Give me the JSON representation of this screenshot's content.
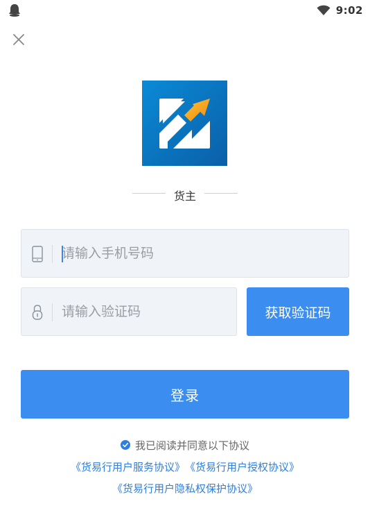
{
  "status_bar": {
    "time": "9:02",
    "left_icon": "notification-bell-icon",
    "signal_icon": "wifi-icon"
  },
  "close": {
    "icon": "close-icon"
  },
  "role": {
    "label": "货主"
  },
  "phone_field": {
    "icon": "phone-icon",
    "placeholder": "请输入手机号码",
    "value": ""
  },
  "code_field": {
    "icon": "lock-icon",
    "placeholder": "请输入验证码",
    "value": ""
  },
  "get_code_button": {
    "label": "获取验证码"
  },
  "login_button": {
    "label": "登录"
  },
  "agreement": {
    "checked": true,
    "text": "我已阅读并同意以下协议",
    "links": [
      "《货易行用户服务协议》",
      "《货易行用户授权协议》",
      "《货易行用户隐私权保护协议》"
    ]
  },
  "colors": {
    "primary": "#3b8ef0",
    "link": "#2f7fe0",
    "input_bg": "#f0f3f7",
    "logo_blue": "#1273c2",
    "logo_arrow": "#f5a623"
  }
}
